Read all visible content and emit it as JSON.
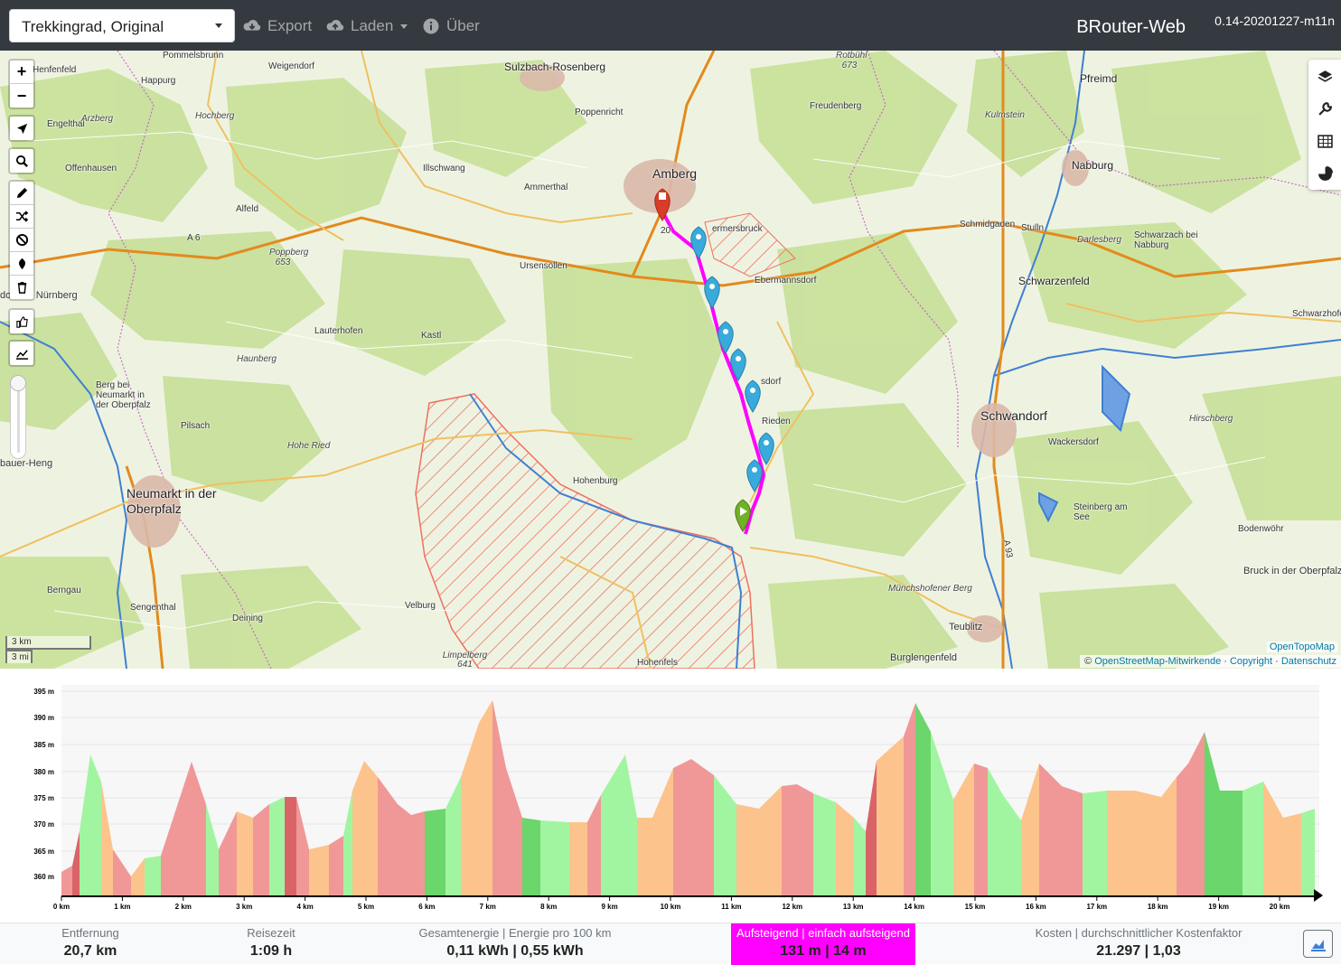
{
  "navbar": {
    "profile": "Trekkingrad, Original",
    "export_label": "Export",
    "load_label": "Laden",
    "about_label": "Über",
    "brand": "BRouter-Web",
    "version": "0.14-20201227-m11n"
  },
  "map": {
    "zoom_in": "+",
    "zoom_out": "−",
    "scale_km": "3 km",
    "scale_mi": "3 mi",
    "attribution_layer": "OpenTopoMap",
    "attribution_prefix": "©",
    "attribution_osm": "OpenStreetMap-Mitwirkende",
    "attribution_copyright": "Copyright",
    "attribution_privacy": "Datenschutz",
    "labels": [
      {
        "text": "Henfenfeld"
      },
      {
        "text": "Pommelsbrunn"
      },
      {
        "text": "Weigendorf"
      },
      {
        "text": "Sulzbach-Rosenberg"
      },
      {
        "text": "Rotbühl 673"
      },
      {
        "text": "Pfreimd"
      },
      {
        "text": "Happurg"
      },
      {
        "text": "Poppenricht"
      },
      {
        "text": "Freudenberg"
      },
      {
        "text": "Kulmstein"
      },
      {
        "text": "Engelthal"
      },
      {
        "text": "Arzberg"
      },
      {
        "text": "Hochberg"
      },
      {
        "text": "Offenhausen"
      },
      {
        "text": "Illschwang"
      },
      {
        "text": "Amberg"
      },
      {
        "text": "Nabburg"
      },
      {
        "text": "Ammerthal"
      },
      {
        "text": "Alfeld"
      },
      {
        "text": "Schmidgaden"
      },
      {
        "text": "Stulln"
      },
      {
        "text": "Schwarzach bei Nabburg"
      },
      {
        "text": "Darlesberg"
      },
      {
        "text": "Poppberg 653"
      },
      {
        "text": "Ursensollen"
      },
      {
        "text": "Ebermannsdorf"
      },
      {
        "text": "Schwarzenfeld"
      },
      {
        "text": "dorf bei Nürnberg"
      },
      {
        "text": "Lauterhofen"
      },
      {
        "text": "Kastl"
      },
      {
        "text": "Haunberg"
      },
      {
        "text": "Berg bei Neumarkt in der Oberpfalz"
      },
      {
        "text": "Rieden"
      },
      {
        "text": "Schwandorf"
      },
      {
        "text": "Hirschberg"
      },
      {
        "text": "Pilsach"
      },
      {
        "text": "Hohe Ried"
      },
      {
        "text": "Wackersdorf"
      },
      {
        "text": "Hohenburg"
      },
      {
        "text": "Neumarkt in der Oberpfalz"
      },
      {
        "text": "Steinberg am See"
      },
      {
        "text": "Bodenwöhr"
      },
      {
        "text": "Berngau"
      },
      {
        "text": "Sengenthal"
      },
      {
        "text": "Velburg"
      },
      {
        "text": "Münchshofener Berg"
      },
      {
        "text": "Bruck in der Oberpfalz"
      },
      {
        "text": "Deining"
      },
      {
        "text": "Teublitz"
      },
      {
        "text": "Burglengenfeld"
      },
      {
        "text": "Limpelberg 641"
      },
      {
        "text": "Hohenfels"
      },
      {
        "text": "Schwarzhofen"
      },
      {
        "text": "ermersbruck"
      },
      {
        "text": "sdorf"
      },
      {
        "text": "A 6"
      },
      {
        "text": "A 93"
      },
      {
        "text": "20"
      },
      {
        "text": "bauer-Heng"
      }
    ]
  },
  "elevation": {
    "y_ticks": [
      "395 m",
      "390 m",
      "385 m",
      "380 m",
      "375 m",
      "370 m",
      "365 m",
      "360 m"
    ],
    "x_ticks": [
      "0 km",
      "1 km",
      "2 km",
      "3 km",
      "4 km",
      "5 km",
      "6 km",
      "7 km",
      "8 km",
      "9 km",
      "10 km",
      "11 km",
      "12 km",
      "13 km",
      "14 km",
      "15 km",
      "16 km",
      "17 km",
      "18 km",
      "19 km",
      "20 km"
    ],
    "colors": {
      "green": "#a2f5a0",
      "dark_green": "#6bd66b",
      "orange": "#fdc38c",
      "red": "#f09897",
      "dark_red": "#d96468"
    }
  },
  "summary": {
    "distance_label": "Entfernung",
    "distance_value": "20,7 km",
    "time_label": "Reisezeit",
    "time_value": "1:09 h",
    "energy_label": "Gesamtenergie | Energie pro 100 km",
    "energy_value": "0,11 kWh | 0,55 kWh",
    "ascent_label": "Aufsteigend | einfach aufsteigend",
    "ascent_value": "131 m | 14 m",
    "cost_label": "Kosten | durchschnittlicher Kostenfaktor",
    "cost_value": "21.297 | 1,03",
    "highlight_color": "#ff00ff"
  }
}
